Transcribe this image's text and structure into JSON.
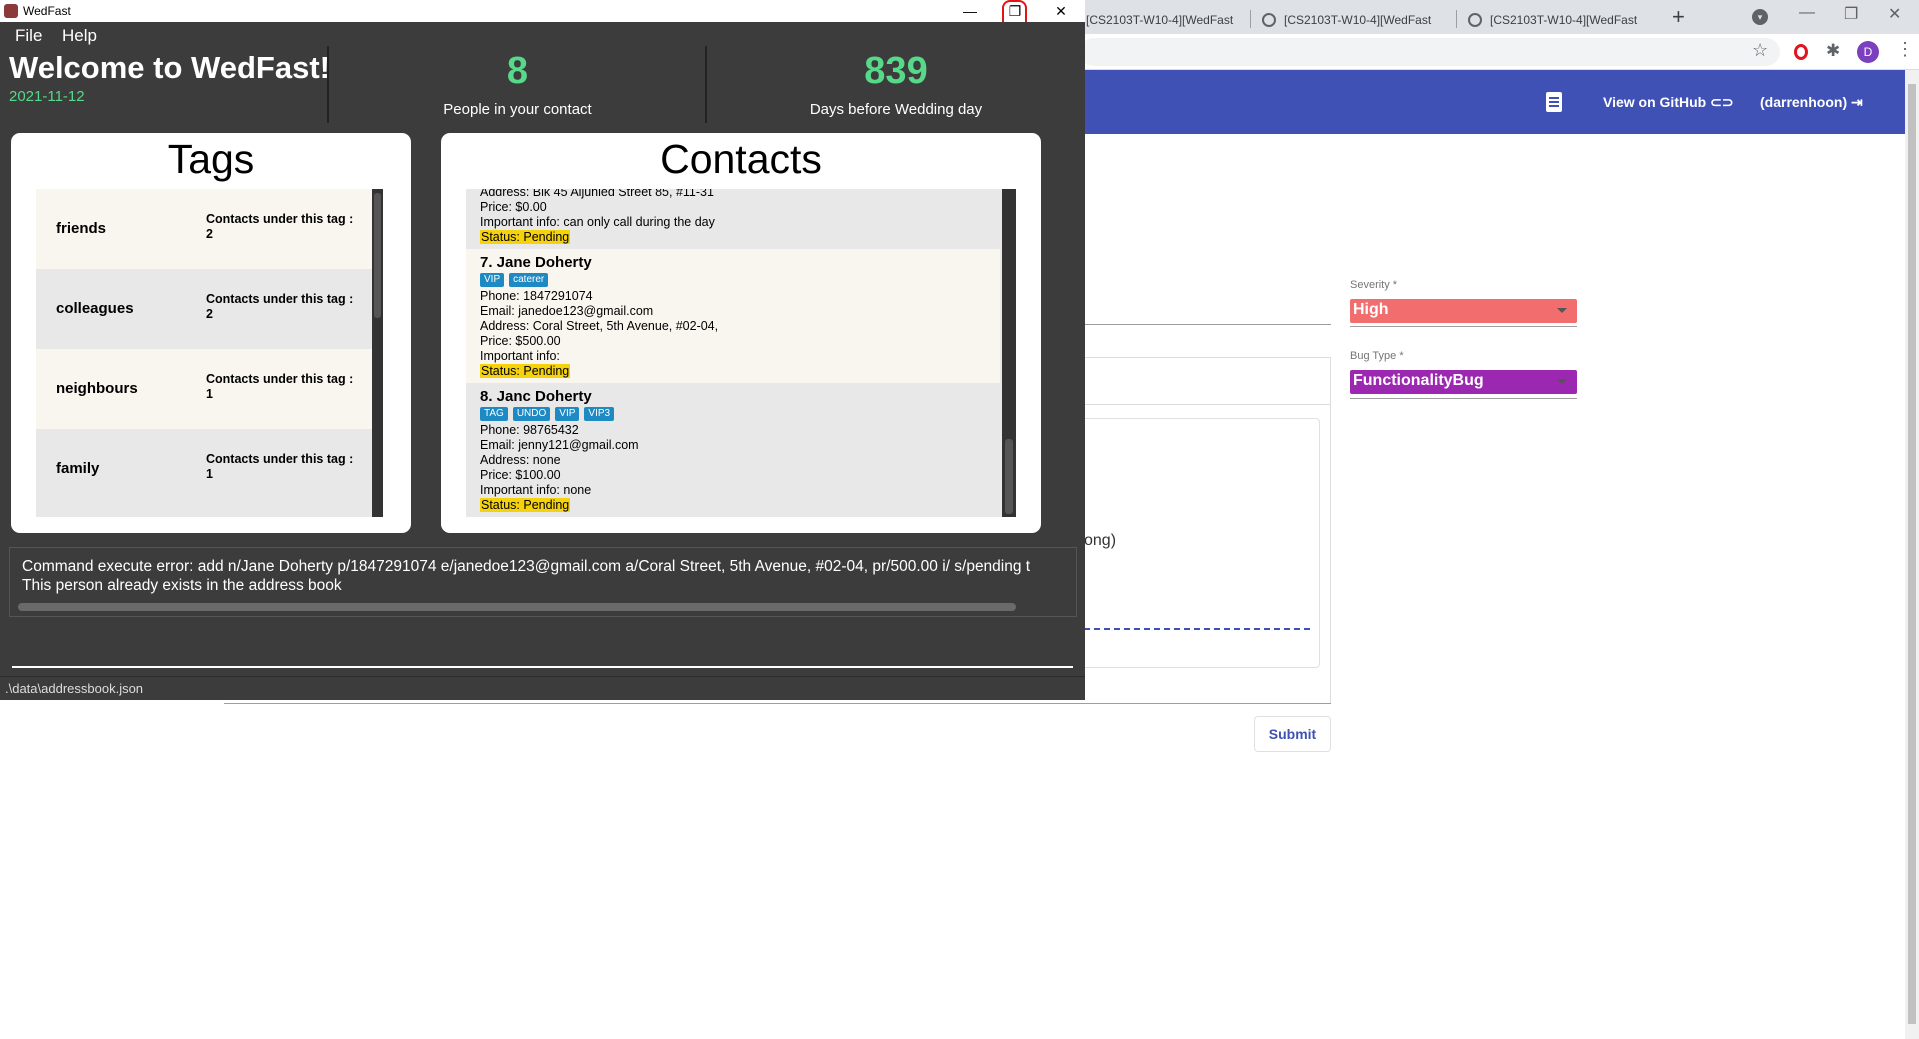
{
  "browser": {
    "tabs": [
      {
        "title": "[CS2103T-W10-4][WedFast"
      },
      {
        "title": "[CS2103T-W10-4][WedFast"
      },
      {
        "title": "[CS2103T-W10-4][WedFast"
      }
    ],
    "new_tab_glyph": "+",
    "profile_initial": "D",
    "appbar": {
      "github_label": "View on GitHub",
      "user_label": "(darrenhoon)"
    },
    "form": {
      "severity_label": "Severity *",
      "severity_value": "High",
      "severity_color": "#f26d6d",
      "bugtype_label": "Bug Type *",
      "bugtype_value": "FunctionalityBug",
      "bugtype_color": "#9c27b0",
      "partial_text": "ong)",
      "submit_label": "Submit"
    },
    "accent_color": "#3f51b5"
  },
  "wedfast": {
    "window_title": "WedFast",
    "menu": [
      "File",
      "Help"
    ],
    "welcome": "Welcome to WedFast!",
    "date": "2021-11-12",
    "people_count": "8",
    "people_label": "People in your contact",
    "days_count": "839",
    "days_label": "Days before Wedding day",
    "accent_green": "#57d98a",
    "tags_title": "Tags",
    "tags": [
      {
        "name": "friends",
        "count_label": "Contacts under this tag :",
        "count": "2"
      },
      {
        "name": "colleagues",
        "count_label": "Contacts under this tag :",
        "count": "2"
      },
      {
        "name": "neighbours",
        "count_label": "Contacts under this tag :",
        "count": "1"
      },
      {
        "name": "family",
        "count_label": "Contacts under this tag :",
        "count": "1"
      }
    ],
    "contacts_title": "Contacts",
    "contact_partial": {
      "address": "Address: Blk 45 Aljunied Street 85, #11-31",
      "price": "Price: $0.00",
      "info": "Important info: can only call during the day",
      "status": "Status: Pending"
    },
    "contacts": [
      {
        "name": "7.  Jane Doherty",
        "tags": [
          "VIP",
          "caterer"
        ],
        "phone": "Phone: 1847291074",
        "email": "Email: janedoe123@gmail.com",
        "address": "Address: Coral Street, 5th Avenue, #02-04,",
        "price": "Price: $500.00",
        "info": "Important info:",
        "status": "Status: Pending"
      },
      {
        "name": "8.  Janc Doherty",
        "tags": [
          "TAG",
          "UNDO",
          "VIP",
          "VIP3"
        ],
        "phone": "Phone: 98765432",
        "email": "Email: jenny121@gmail.com",
        "address": "Address: none",
        "price": "Price: $100.00",
        "info": "Important info: none",
        "status": "Status: Pending"
      }
    ],
    "result_line1": "Command execute error: add n/Jane Doherty p/1847291074 e/janedoe123@gmail.com a/Coral Street, 5th Avenue, #02-04, pr/500.00 i/ s/pending t",
    "result_line2": "This person already exists in the address book",
    "command_value": "",
    "file_path": ".\\data\\addressbook.json"
  }
}
